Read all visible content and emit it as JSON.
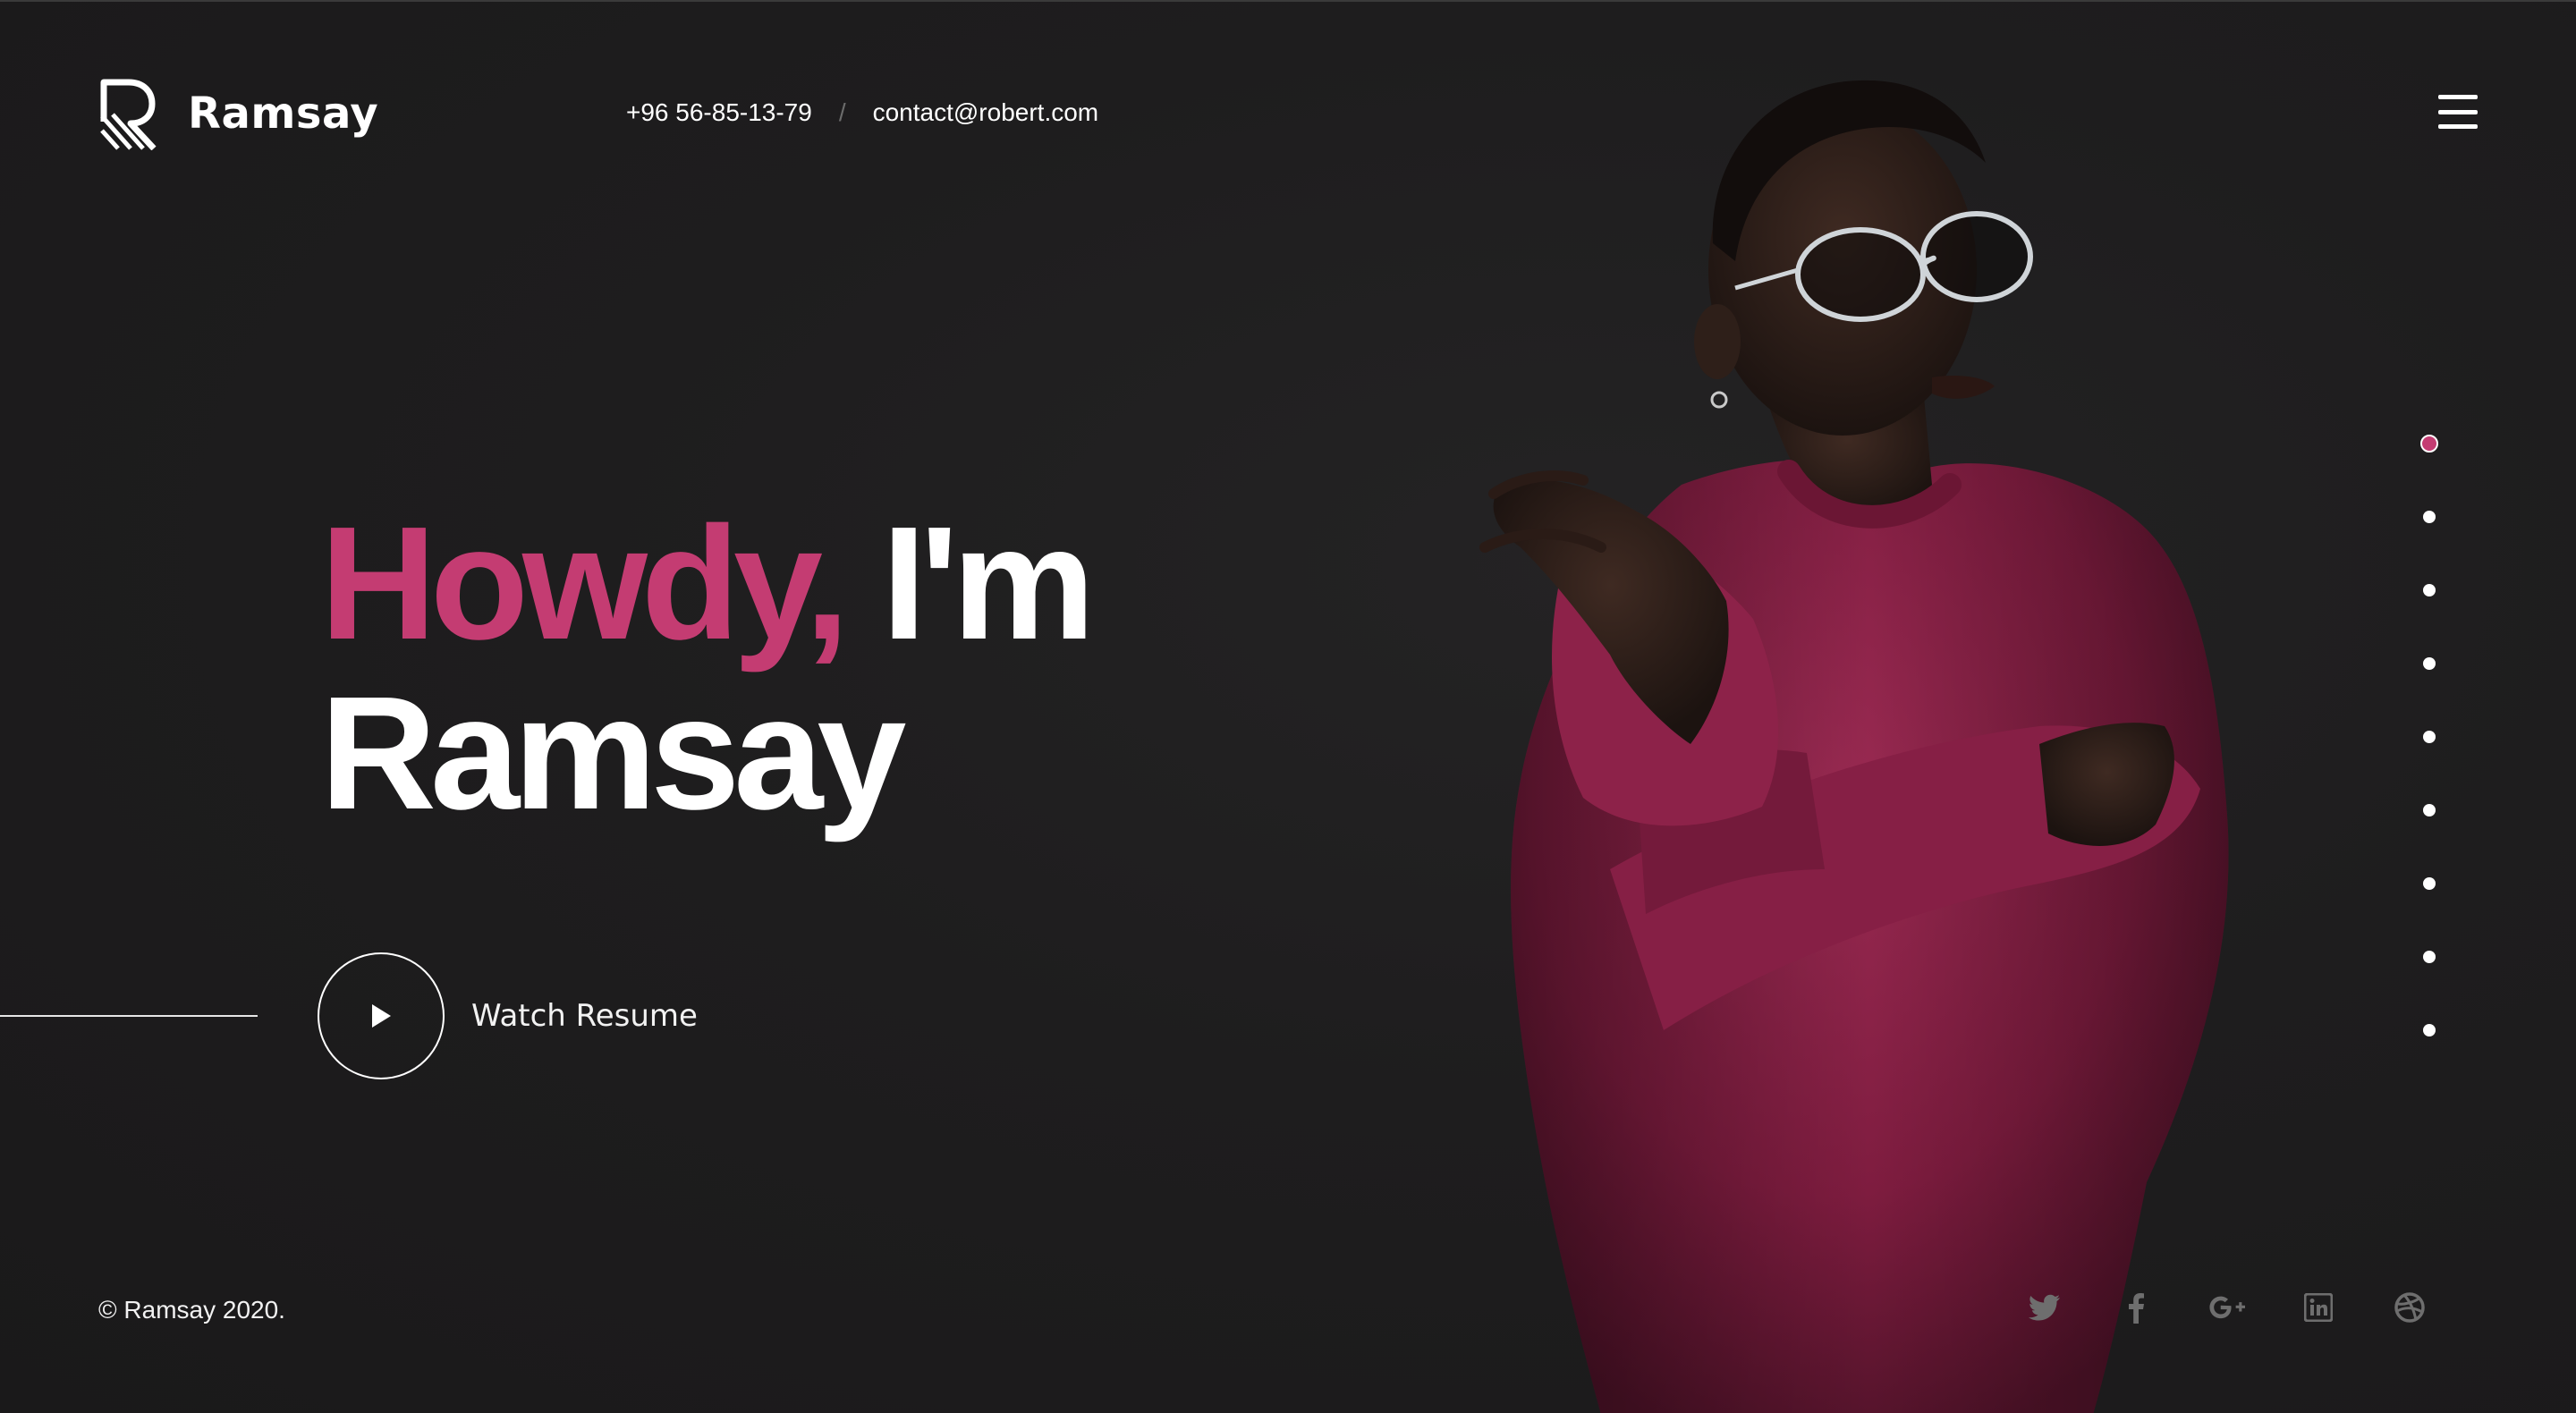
{
  "header": {
    "brand": "Ramsay",
    "phone": "+96 56-85-13-79",
    "separator": "/",
    "email": "contact@robert.com",
    "menu_icon": "hamburger-menu-icon"
  },
  "hero": {
    "headline_accent": "Howdy,",
    "headline_rest": "I'm",
    "headline_name": "Ramsay",
    "watch_label": "Watch Resume",
    "play_icon": "play-icon"
  },
  "side_nav": {
    "count": 9,
    "active_index": 0
  },
  "footer": {
    "copyright": "© Ramsay 2020.",
    "socials": [
      "twitter-icon",
      "facebook-icon",
      "google-plus-icon",
      "linkedin-icon",
      "dribbble-icon"
    ]
  },
  "colors": {
    "accent": "#c43c72",
    "background": "#1d1c1d",
    "sweater": "#8a1f45",
    "social_icon": "#6e6e6e"
  }
}
